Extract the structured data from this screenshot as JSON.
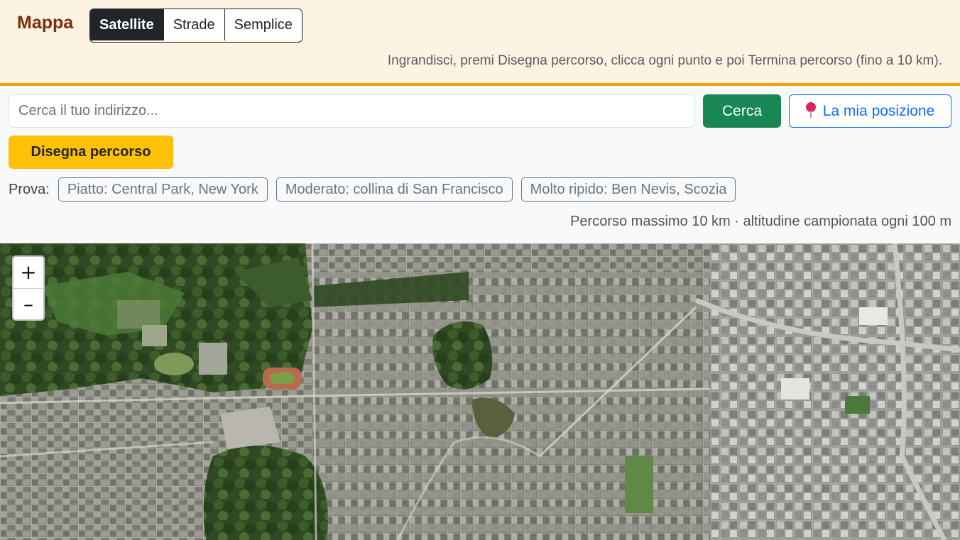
{
  "header": {
    "title": "Mappa",
    "layers": [
      "Satellite",
      "Strade",
      "Semplice"
    ],
    "active_layer": "Satellite",
    "instructions": "Ingrandisci, premi Disegna percorso, clicca ogni punto e poi Termina percorso (fino a 10 km)."
  },
  "search": {
    "placeholder": "Cerca il tuo indirizzo...",
    "value": "",
    "button_label": "Cerca",
    "locate_label": "La mia posizione"
  },
  "draw_button_label": "Disegna percorso",
  "examples": {
    "label": "Prova:",
    "items": [
      "Piatto: Central Park, New York",
      "Moderato: collina di San Francisco",
      "Molto ripido: Ben Nevis, Scozia"
    ]
  },
  "limit_info": "Percorso massimo 10 km · altitudine campionata ogni 100 m",
  "map": {
    "zoom_in": "+",
    "zoom_out": "–"
  },
  "colors": {
    "accent": "#f5a00e",
    "title": "#7a2e0a",
    "search_button": "#198754",
    "locate": "#0d6efd",
    "draw_button": "#ffc107"
  }
}
